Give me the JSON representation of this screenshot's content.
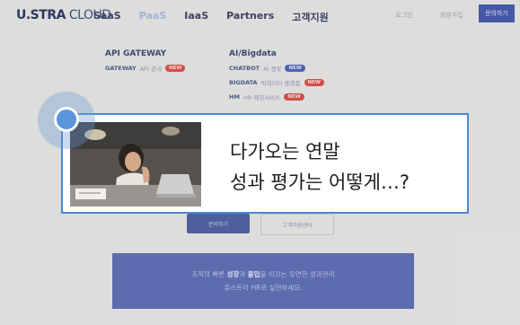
{
  "brand": {
    "logo_bold": "U.STRA",
    "logo_light": " CLOUD"
  },
  "nav": {
    "items": [
      "SaaS",
      "PaaS",
      "IaaS",
      "Partners",
      "고객지원"
    ],
    "login": "로그인",
    "signup": "회원가입",
    "contact": "문의하기"
  },
  "mega_menu": {
    "api": {
      "title": "API GATEWAY",
      "items": [
        {
          "name": "GATEWAY",
          "sub": "API 관리",
          "badge": "NEW"
        }
      ]
    },
    "ai": {
      "title": "AI/Bigdata",
      "items": [
        {
          "name": "CHATBOT",
          "sub": "AI 챗봇",
          "badge": "NEW"
        },
        {
          "name": "BIGDATA",
          "sub": "빅데이터 플랫폼",
          "badge": "NEW"
        },
        {
          "name": "HM",
          "sub": "HR 매칭서비스",
          "badge": "NEW"
        }
      ]
    }
  },
  "buttons": {
    "primary": "문의하기",
    "secondary": "고객지원센터"
  },
  "banner": {
    "line1_pre": "조직의 빠른 ",
    "line1_b1": "성장",
    "line1_mid": "과 ",
    "line1_b2": "몰입",
    "line1_post": "을 이끄는 유연한 성과관리",
    "line2": "유스트라 HR로 실현하세요."
  },
  "popup": {
    "line1": "다가오는 연말",
    "line2": "성과 평가는 어떻게…?"
  },
  "colors": {
    "accent": "#4458a8",
    "popup_border": "#4c88d4",
    "badge_red": "#d94c48"
  }
}
